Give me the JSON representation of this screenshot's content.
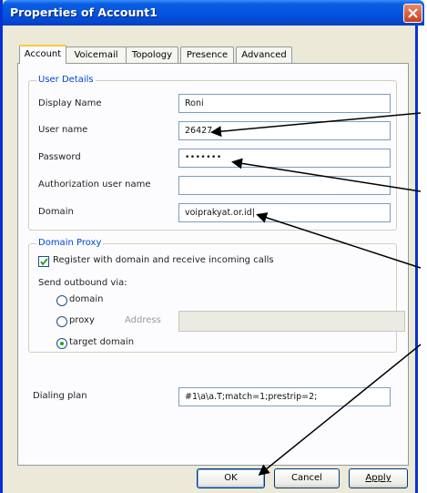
{
  "window": {
    "title": "Properties of Account1"
  },
  "tabs": [
    {
      "label": "Account",
      "active": true
    },
    {
      "label": "Voicemail",
      "active": false
    },
    {
      "label": "Topology",
      "active": false
    },
    {
      "label": "Presence",
      "active": false
    },
    {
      "label": "Advanced",
      "active": false
    }
  ],
  "user_details": {
    "legend": "User Details",
    "display_name": {
      "label": "Display Name",
      "value": "Roni"
    },
    "user_name": {
      "label": "User name",
      "value": "26427"
    },
    "password": {
      "label": "Password",
      "value": "•••••••"
    },
    "auth_user": {
      "label": "Authorization user name",
      "value": ""
    },
    "domain": {
      "label": "Domain",
      "value": "voiprakyat.or.id"
    }
  },
  "domain_proxy": {
    "legend": "Domain Proxy",
    "register_label": "Register with domain and receive incoming calls",
    "register_checked": true,
    "send_via_label": "Send outbound via:",
    "options": [
      {
        "label": "domain",
        "selected": false
      },
      {
        "label": "proxy",
        "selected": false
      },
      {
        "label": "target domain",
        "selected": true
      }
    ],
    "address_label": "Address",
    "address_value": ""
  },
  "dialing_plan": {
    "label": "Dialing plan",
    "value": "#1\\a\\a.T;match=1;prestrip=2;"
  },
  "buttons": {
    "ok": "OK",
    "cancel": "Cancel",
    "apply": "Apply"
  },
  "colors": {
    "titlebar": "#0554e3",
    "accent": "#ffc83c",
    "legend": "#0046d5",
    "window_bg": "#ece9d8"
  },
  "icons": {
    "close": "close-icon",
    "check": "check-icon",
    "radio_dot": "radio-dot-icon"
  }
}
